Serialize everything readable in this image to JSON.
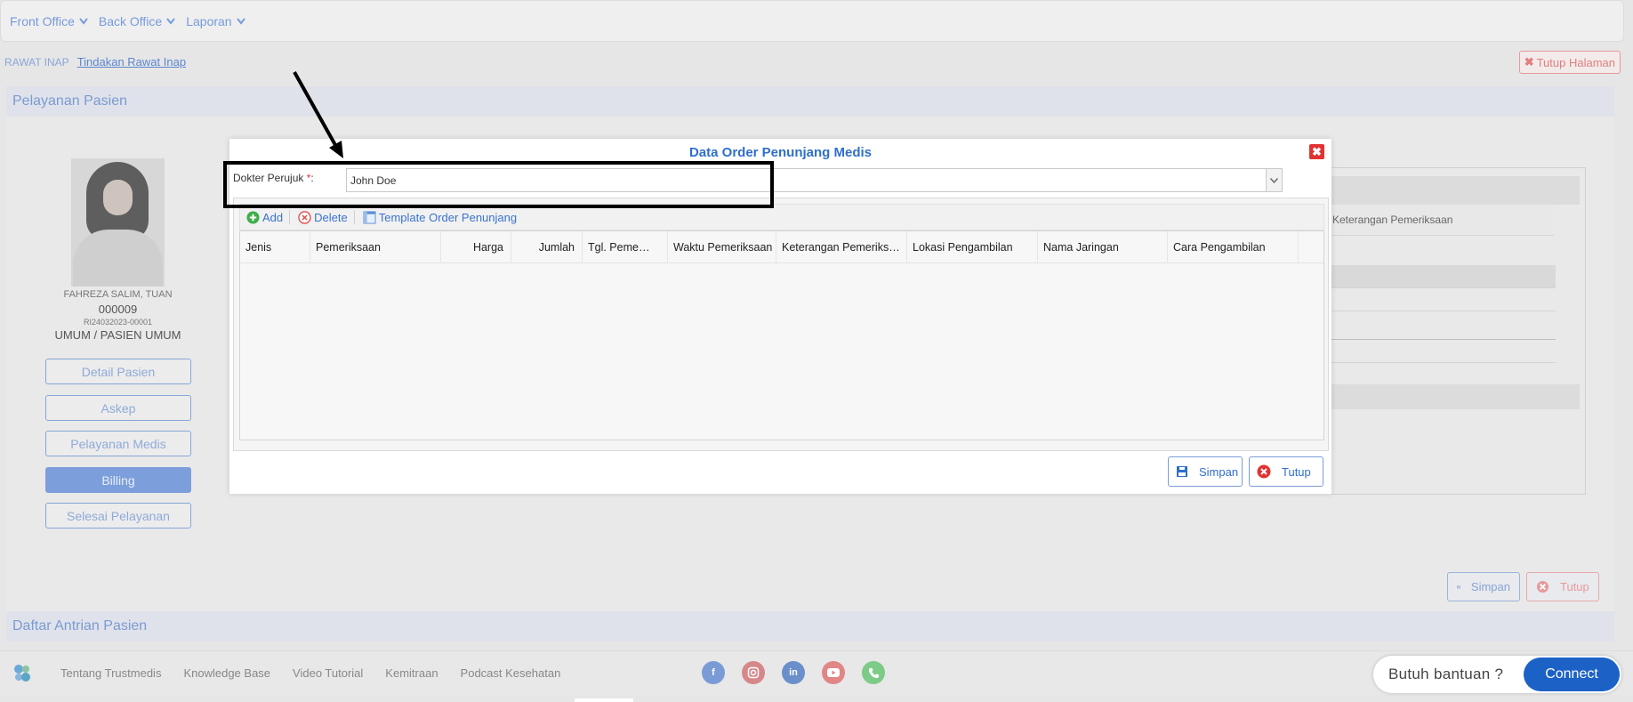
{
  "topnav": {
    "items": [
      "Front Office",
      "Back Office",
      "Laporan"
    ]
  },
  "breadcrumb": {
    "root": "RAWAT INAP",
    "current": "Tindakan Rawat Inap"
  },
  "page": {
    "close_page_label": "Tutup Halaman"
  },
  "sections": {
    "pelayanan": "Pelayanan Pasien",
    "antrian": "Daftar Antrian Pasien"
  },
  "patient": {
    "name": "FAHREZA SALIM, TUAN",
    "id": "000009",
    "registration": "RI24032023-00001",
    "type": "UMUM / PASIEN UMUM"
  },
  "side_buttons": [
    "Detail Pasien",
    "Askep",
    "Pelayanan Medis",
    "Billing",
    "Selesai Pelayanan"
  ],
  "background": {
    "ket_column": "Keterangan Pemeriksaan",
    "simpan": "Simpan",
    "tutup": "Tutup"
  },
  "modal": {
    "title": "Data Order Penunjang Medis",
    "close_glyph": "✖",
    "field_label": "Dokter Perujuk",
    "required_mark": "*",
    "colon": ":",
    "dokter_value": "John Doe",
    "toolbar": {
      "add": "Add",
      "delete": "Delete",
      "template": "Template Order Penunjang"
    },
    "columns": [
      "Jenis",
      "Pemeriksaan",
      "Harga",
      "Jumlah",
      "Tgl. Peme…",
      "Waktu Pemeriksaan",
      "Keterangan Pemeriks…",
      "Lokasi Pengambilan",
      "Nama Jaringan",
      "Cara Pengambilan"
    ],
    "simpan": "Simpan",
    "tutup": "Tutup"
  },
  "footer": {
    "links": [
      "Tentang Trustmedis",
      "Knowledge Base",
      "Video Tutorial",
      "Kemitraan",
      "Podcast Kesehatan"
    ],
    "help_text": "Butuh bantuan ?",
    "connect": "Connect"
  },
  "colors": {
    "accent": "#2f6fcc",
    "danger": "#e23232",
    "connect": "#1c62c6"
  }
}
